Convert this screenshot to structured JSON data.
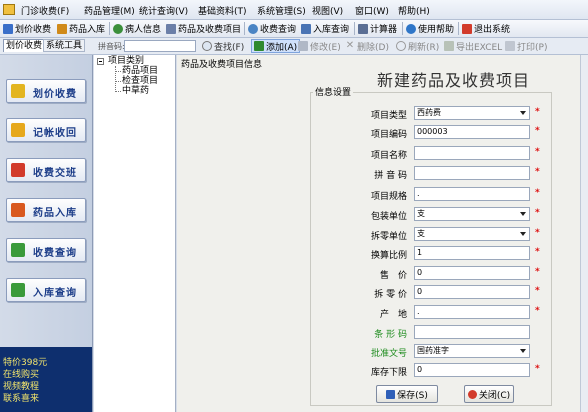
{
  "menu": {
    "items": [
      "门诊收费(F)",
      "药品管理(M)",
      "统计查询(V)",
      "基础资料(T)",
      "系统管理(S)",
      "视图(V)",
      "窗口(W)",
      "帮助(H)"
    ]
  },
  "toolbar": {
    "items": [
      {
        "label": "划价收费",
        "icon": "pen-icon",
        "color": "#3a6fc9"
      },
      {
        "label": "药品入库",
        "icon": "arrow-in-icon",
        "color": "#d08a1a"
      },
      {
        "label": "病人信息",
        "icon": "person-icon",
        "color": "#3b8f3b"
      },
      {
        "label": "药品及收费项目",
        "icon": "grid-icon",
        "color": "#6b7fa8"
      },
      {
        "label": "收费查询",
        "icon": "magnifier-icon",
        "color": "#4a84c4"
      },
      {
        "label": "入库查询",
        "icon": "list-icon",
        "color": "#4a74b4"
      },
      {
        "label": "计算器",
        "icon": "calculator-icon",
        "color": "#5a6e94"
      },
      {
        "label": "使用帮助",
        "icon": "help-icon",
        "color": "#2f76c8"
      },
      {
        "label": "退出系统",
        "icon": "exit-icon",
        "color": "#d23b2b"
      }
    ]
  },
  "tabs": {
    "active": "划价收费",
    "inactive": "系统工具"
  },
  "search": {
    "label": "拼音码:"
  },
  "actions": [
    {
      "label": "查找(F)",
      "icon": "find-icon",
      "state": "normal"
    },
    {
      "label": "添加(A)",
      "icon": "plus-icon",
      "state": "highlighted"
    },
    {
      "label": "修改(E)",
      "icon": "edit-icon",
      "state": "disabled"
    },
    {
      "label": "删除(D)",
      "icon": "delete-icon",
      "state": "disabled"
    },
    {
      "label": "刷新(R)",
      "icon": "refresh-icon",
      "state": "disabled"
    },
    {
      "label": "导出EXCEL",
      "icon": "excel-icon",
      "state": "disabled"
    },
    {
      "label": "打印(P)",
      "icon": "print-icon",
      "state": "disabled"
    }
  ],
  "sidebar": {
    "items": [
      {
        "label": "划价收费",
        "icon": "coin-icon",
        "color": "#e3b520"
      },
      {
        "label": "记帐收回",
        "icon": "ledger-icon",
        "color": "#e6a81c"
      },
      {
        "label": "收费交班",
        "icon": "handover-icon",
        "color": "#d23b2b"
      },
      {
        "label": "药品入库",
        "icon": "medicine-icon",
        "color": "#d9591f"
      },
      {
        "label": "收费查询",
        "icon": "query-icon",
        "color": "#3a9a3a"
      },
      {
        "label": "入库查询",
        "icon": "stock-icon",
        "color": "#3a9a3a"
      }
    ],
    "promo": [
      "特价398元",
      "在线购买",
      "视频教程",
      "联系喜来"
    ]
  },
  "tree": {
    "root": "项目类别",
    "children": [
      "药品项目",
      "检查项目",
      "中草药"
    ]
  },
  "main": {
    "breadcrumb": "药品及收费项目信息",
    "title": "新建药品及收费项目",
    "group_label": "信息设置"
  },
  "form": {
    "fields": [
      {
        "label": "项目类型",
        "value": "西药费",
        "type": "select",
        "required": true,
        "green": false
      },
      {
        "label": "项目编码",
        "value": "000003",
        "type": "text",
        "required": true,
        "green": false
      },
      {
        "label": "项目名称",
        "value": "",
        "type": "text",
        "required": true,
        "green": false
      },
      {
        "label": "拼 音 码",
        "value": "",
        "type": "text",
        "required": true,
        "green": false
      },
      {
        "label": "项目规格",
        "value": ".",
        "type": "text",
        "required": true,
        "green": false
      },
      {
        "label": "包装单位",
        "value": "支",
        "type": "select",
        "required": true,
        "green": false
      },
      {
        "label": "拆零单位",
        "value": "支",
        "type": "select",
        "required": true,
        "green": false
      },
      {
        "label": "换算比例",
        "value": "1",
        "type": "text",
        "required": true,
        "green": false
      },
      {
        "label": "售　价",
        "value": "0",
        "type": "text",
        "required": true,
        "green": false
      },
      {
        "label": "拆 零 价",
        "value": "0",
        "type": "text",
        "required": true,
        "green": false
      },
      {
        "label": "产　地",
        "value": ".",
        "type": "text",
        "required": true,
        "green": false
      },
      {
        "label": "条 形 码",
        "value": "",
        "type": "text",
        "required": false,
        "green": true
      },
      {
        "label": "批准文号",
        "value": "国药准字",
        "type": "select",
        "required": false,
        "green": true
      },
      {
        "label": "库存下限",
        "value": "0",
        "type": "text",
        "required": true,
        "green": false
      }
    ],
    "required_mark": "*",
    "save_label": "保存(S)",
    "close_label": "关闭(C)"
  }
}
